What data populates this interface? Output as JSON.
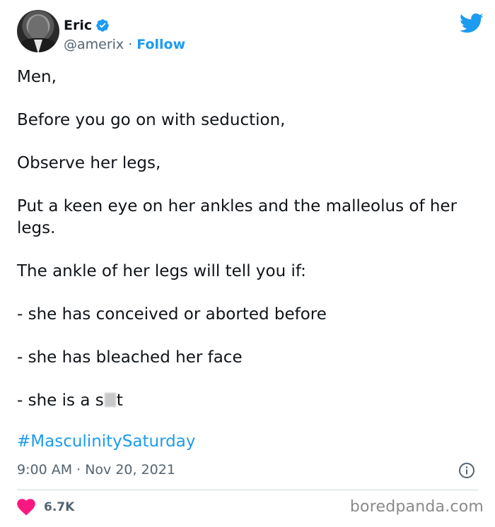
{
  "author": {
    "name": "Eric",
    "handle": "@amerix",
    "separator": "·",
    "follow_label": "Follow"
  },
  "tweet": {
    "paragraphs": [
      "Men,",
      "Before you go on with seduction,",
      "Observe her legs,",
      "Put a keen eye on her ankles and the malleolus of her legs.",
      "The ankle of her legs will tell you if:",
      "- she has conceived or aborted before",
      "- she has bleached her face"
    ],
    "last_line_prefix": "- she is a s",
    "last_line_suffix": "t",
    "hashtag": "#MasculinitySaturday",
    "timestamp": "9:00 AM · Nov 20, 2021"
  },
  "engagement": {
    "likes": "6.7K"
  },
  "watermark": "boredpanda.com",
  "colors": {
    "accent": "#1d9bf0",
    "heart": "#f91880",
    "text": "#0f1419",
    "muted": "#536471"
  },
  "icons": [
    "verified-badge-icon",
    "twitter-bird-icon",
    "info-icon",
    "heart-icon"
  ]
}
